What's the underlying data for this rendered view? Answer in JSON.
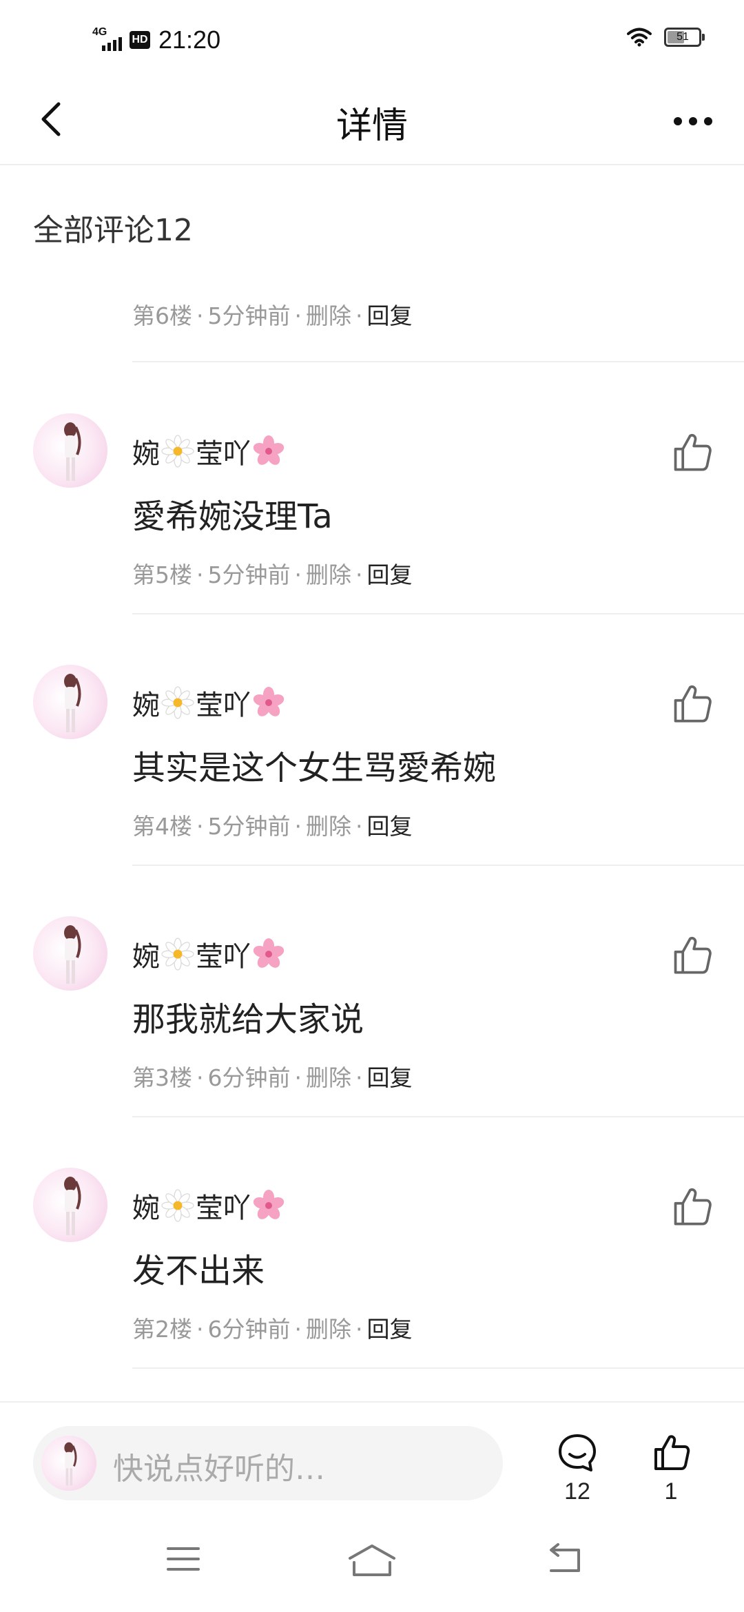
{
  "status_bar": {
    "network": "4G",
    "hd": "HD",
    "time": "21:20",
    "battery": "51"
  },
  "header": {
    "title": "详情"
  },
  "comments_section": {
    "title": "全部评论12",
    "first_meta": {
      "floor": "第6楼",
      "time": "5分钟前",
      "delete": "删除",
      "reply": "回复"
    },
    "items": [
      {
        "name_a": "婉",
        "name_b": "莹吖",
        "body": "愛希婉没理Ta",
        "floor": "第5楼",
        "time": "5分钟前",
        "delete": "删除",
        "reply": "回复"
      },
      {
        "name_a": "婉",
        "name_b": "莹吖",
        "body": "其实是这个女生骂愛希婉",
        "floor": "第4楼",
        "time": "5分钟前",
        "delete": "删除",
        "reply": "回复"
      },
      {
        "name_a": "婉",
        "name_b": "莹吖",
        "body": "那我就给大家说",
        "floor": "第3楼",
        "time": "6分钟前",
        "delete": "删除",
        "reply": "回复"
      },
      {
        "name_a": "婉",
        "name_b": "莹吖",
        "body": "发不出来",
        "floor": "第2楼",
        "time": "6分钟前",
        "delete": "删除",
        "reply": "回复"
      }
    ]
  },
  "bottom_bar": {
    "input_placeholder": "快说点好听的…",
    "comment_count": "12",
    "like_count": "1"
  },
  "icons": {
    "back": "back-arrow-icon",
    "more": "more-icon",
    "like": "thumbs-up-icon",
    "comment": "comment-bubble-icon",
    "daisy": "daisy-emoji",
    "sakura": "cherry-blossom-emoji",
    "nav_menu": "menu-icon",
    "nav_home": "home-icon",
    "nav_back": "return-icon"
  },
  "colors": {
    "meta_gray": "#999999",
    "divider": "#eeeeee",
    "text": "#222222",
    "avatar_pink": "#fbe6f3"
  }
}
